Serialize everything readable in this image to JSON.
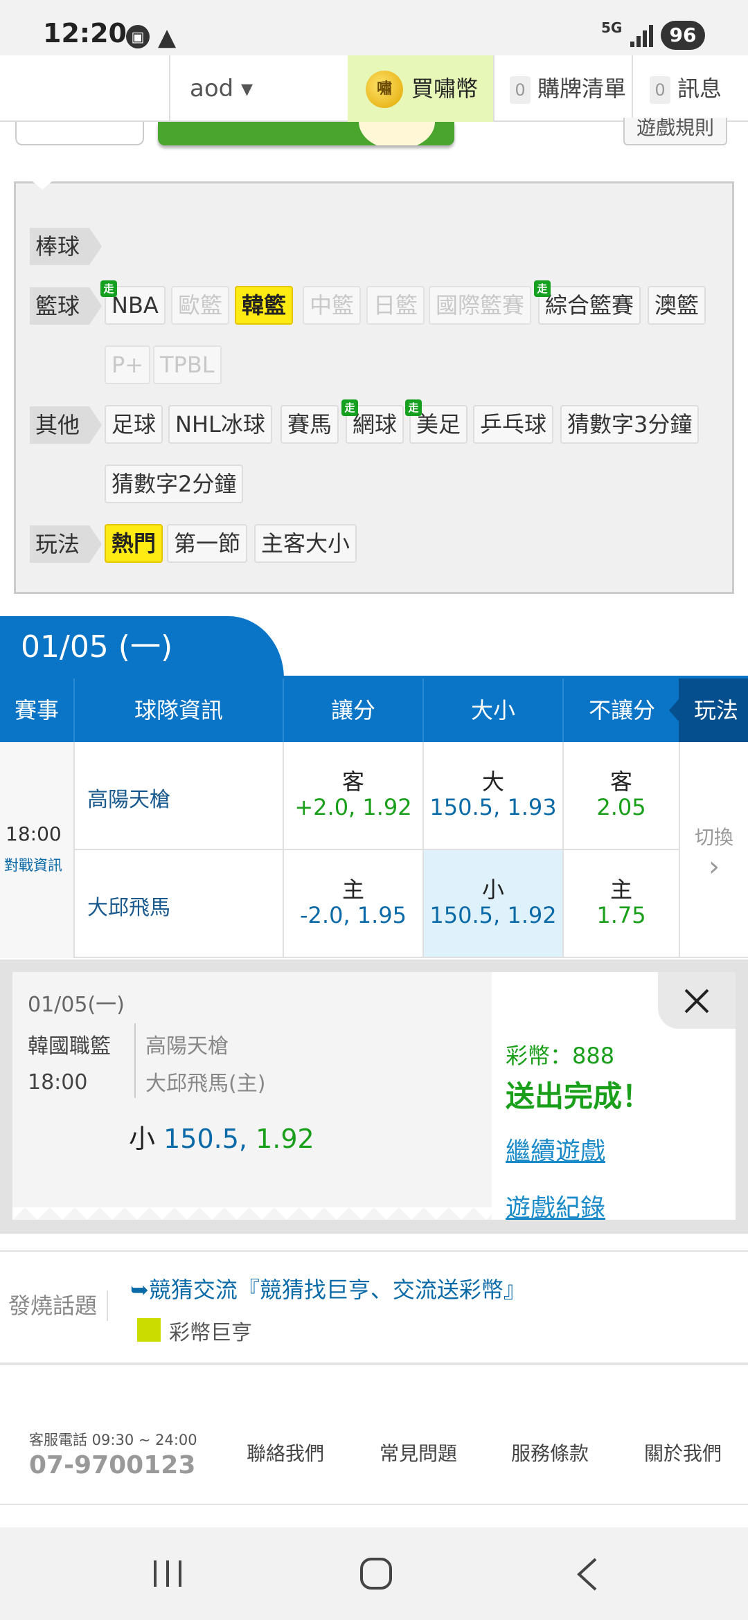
{
  "status_bar": {
    "time": "12:20",
    "network": "5G",
    "battery": "96"
  },
  "header": {
    "user": "aod ▾",
    "coin_icon_label": "嘯",
    "buy_coins": "買嘯幣",
    "cart_count": "0",
    "cart": "購牌清單",
    "msg_count": "0",
    "messages": "訊息",
    "game_rules": "遊戲規則"
  },
  "filters": {
    "baseball": {
      "label": "棒球"
    },
    "basketball": {
      "label": "籃球",
      "chips": [
        "NBA",
        "歐籃",
        "韓籃",
        "中籃",
        "日籃",
        "國際籃賽",
        "綜合籃賽",
        "澳籃",
        "P+",
        "TPBL"
      ]
    },
    "other": {
      "label": "其他",
      "chips": [
        "足球",
        "NHL冰球",
        "賽馬",
        "網球",
        "美足",
        "乒乓球",
        "猜數字3分鐘",
        "猜數字2分鐘"
      ]
    },
    "play": {
      "label": "玩法",
      "chips": [
        "熱門",
        "第一節",
        "主客大小"
      ]
    },
    "walk_badge": "走"
  },
  "date_tab": "01/05 (一)",
  "table": {
    "headers": {
      "event": "賽事",
      "team_info": "球隊資訊",
      "spread": "讓分",
      "total": "大小",
      "moneyline": "不讓分",
      "play": "玩法"
    },
    "time": "18:00",
    "match_info": "對戰資訊",
    "away_team": "高陽天槍",
    "home_team": "大邱飛馬",
    "away": {
      "spread_label": "客",
      "spread_value": "+2.0, 1.92",
      "total_label": "大",
      "total_value": "150.5, 1.93",
      "ml_label": "客",
      "ml_value": "2.05"
    },
    "home": {
      "spread_label": "主",
      "spread_value": "-2.0, 1.95",
      "total_label": "小",
      "total_value": "150.5, 1.92",
      "ml_label": "主",
      "ml_value": "1.75"
    },
    "switch_label": "切換",
    "switch_arrow": "›"
  },
  "result": {
    "date": "01/05(一)",
    "league": "韓國職籃",
    "time": "18:00",
    "away_team": "高陽天槍",
    "home_team": "大邱飛馬(主)",
    "pick_side": "小",
    "pick_line": "150.5,",
    "pick_odds": "1.92",
    "coin": "彩幣：888",
    "done": "送出完成！",
    "continue": "繼續遊戲",
    "history": "遊戲紀錄"
  },
  "hot_topics": {
    "label": "發燒話題",
    "link": "➥競猜交流『競猜找巨亨、交流送彩幣』",
    "sub": "彩幣巨亨"
  },
  "footer": {
    "service_label": "客服電話 09:30 ~ 24:00",
    "phone": "07-9700123",
    "contact": "聯絡我們",
    "faq": "常見問題",
    "terms": "服務條款",
    "about": "關於我們"
  },
  "colors": {
    "primary_blue": "#0a74c6",
    "accent_yellow": "#ffeb14",
    "green": "#1a9f1a"
  }
}
